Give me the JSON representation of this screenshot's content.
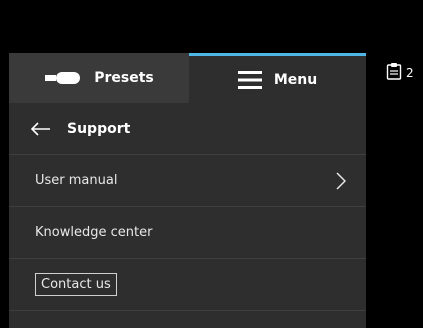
{
  "tabs": {
    "presets_label": "Presets",
    "menu_label": "Menu"
  },
  "support": {
    "title": "Support",
    "items": [
      {
        "label": "User manual"
      },
      {
        "label": "Knowledge center"
      },
      {
        "label": "Contact us"
      }
    ]
  },
  "status": {
    "clipboard_count": "2"
  },
  "colors": {
    "active_tab_accent": "#4fb6e6",
    "panel_bg": "#2e2e2e",
    "presets_tab_bg": "#3a3a3a"
  }
}
